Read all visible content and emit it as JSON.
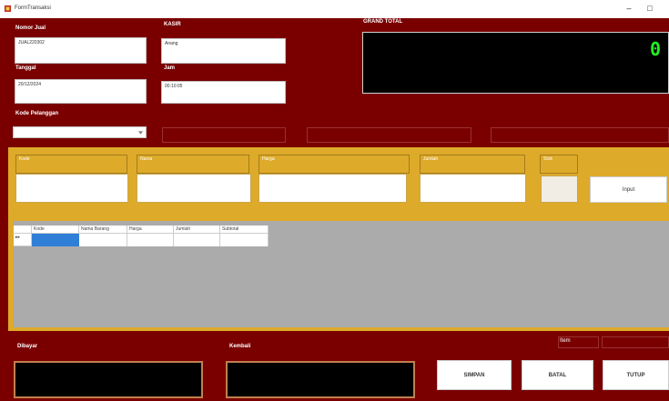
{
  "window": {
    "title": "FormTransaksi",
    "minimize_glyph": "–",
    "maximize_glyph": "□"
  },
  "header": {
    "nomor_jual_label": "Nomor Jual",
    "nomor_jual_value": "JUAL220302",
    "tanggal_label": "Tanggal",
    "tanggal_value": "20/12/2024",
    "kode_pelanggan_label": "Kode Pelanggan",
    "kasir_label": "KASIR",
    "kasir_value": "Anang",
    "jam_label": "Jam",
    "jam_value": "00:10:05",
    "grand_total_label": "GRAND TOTAL",
    "grand_total_value": "0"
  },
  "input_section": {
    "kode_label": "Kode",
    "nama_label": "Nama",
    "harga_label": "Harga",
    "jumlah_label": "Jumlah",
    "stok_label": "Stok",
    "input_button": "Input"
  },
  "table": {
    "row_header": "▸▸",
    "columns": [
      "Kode",
      "Nama Barang",
      "Harga",
      "Jumlah",
      "Subtotal"
    ]
  },
  "footer": {
    "dibayar_label": "Dibayar",
    "kembali_label": "Kembali",
    "item_label": "Item",
    "simpan_button": "SIMPAN",
    "batal_button": "BATAL",
    "tutup_button": "TUTUP"
  },
  "colors": {
    "background": "#7a0000",
    "panel": "#deaa2a",
    "digit": "#22ee22",
    "grid": "#ababab"
  }
}
